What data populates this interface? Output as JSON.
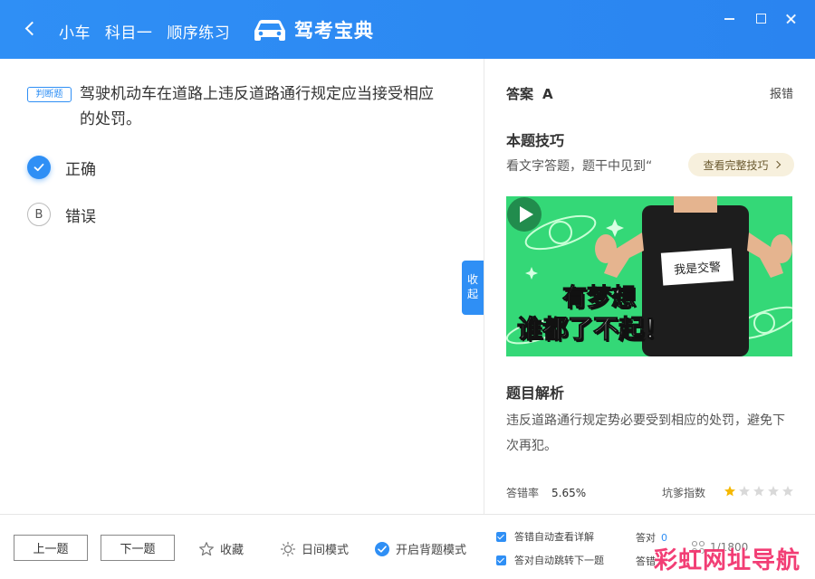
{
  "header": {
    "breadcrumb": [
      "小车",
      "科目一",
      "顺序练习"
    ],
    "logo_text": "驾考宝典"
  },
  "question": {
    "type_tag": "判断题",
    "text": "驾驶机动车在道路上违反道路通行规定应当接受相应的处罚。",
    "options": [
      {
        "marker": "A",
        "label": "正确",
        "selected": true
      },
      {
        "marker": "B",
        "label": "错误",
        "selected": false
      }
    ],
    "collapse_label": "收起"
  },
  "answer_panel": {
    "answer_label": "答案",
    "answer_value": "A",
    "report_label": "报错",
    "tips_title": "本题技巧",
    "tips_text": "看文字答题，题干中见到“",
    "tips_button": "查看完整技巧",
    "video_caption_1": "有梦想",
    "video_caption_2": "谁都了不起！",
    "video_sign": "我是交警",
    "analysis_title": "题目解析",
    "analysis_text": "违反道路通行规定势必要受到相应的处罚，避免下次再犯。",
    "error_rate_label": "答错率",
    "error_rate_value": "5.65%",
    "trap_index_label": "坑爹指数",
    "trap_index_stars": 1,
    "trap_index_max": 5
  },
  "bottom_bar": {
    "prev_label": "上一题",
    "next_label": "下一题",
    "favorite_label": "收藏",
    "day_mode_label": "日间模式",
    "memorize_label": "开启背题模式",
    "auto_detail_label": "答错自动查看详解",
    "auto_next_label": "答对自动跳转下一题",
    "correct_label": "答对",
    "correct_count": "0",
    "wrong_label": "答错",
    "progress": "1/1800",
    "watermark": "彩虹网址导航"
  },
  "colors": {
    "accent": "#2f8ff5",
    "video_bg": "#34d877",
    "tips_button_bg": "#f7f0dd",
    "star_active": "#f5b800",
    "star_inactive": "#d9d9d9",
    "watermark": "#f2346e"
  }
}
